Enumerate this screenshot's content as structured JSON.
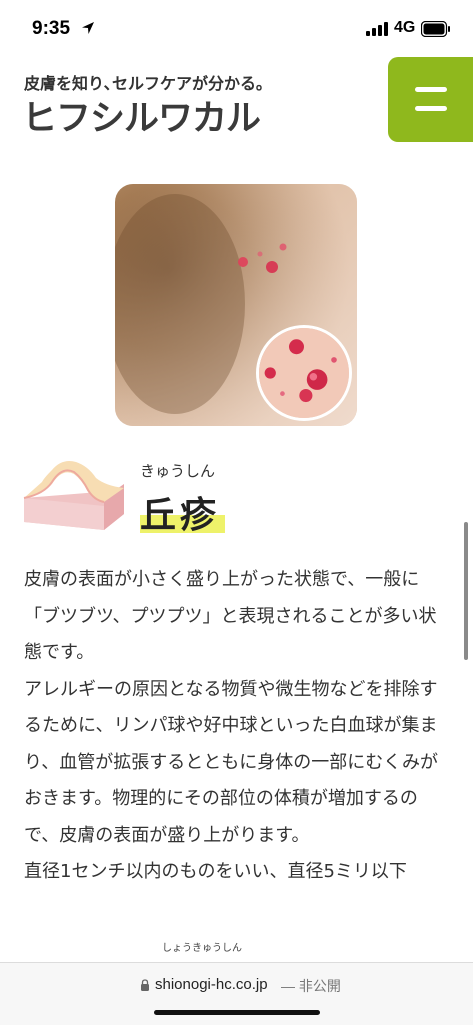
{
  "status_bar": {
    "time": "9:35",
    "network": "4G"
  },
  "header": {
    "tagline": "皮膚を知り､セルフケアが分かる｡",
    "logo": "ヒフシルワカル",
    "menu_icon": "hamburger-icon",
    "accent_color": "#8fb81d"
  },
  "term": {
    "reading": "きゅうしん",
    "name": "丘疹",
    "highlight_color": "#eef26a"
  },
  "body": {
    "paragraphs": [
      "皮膚の表面が小さく盛り上がった状態で、一般に「ブツブツ、プツプツ」と表現されることが多い状態です。",
      "アレルギーの原因となる物質や微生物などを排除するために、リンパ球や好中球といった白血球が集まり、血管が拡張するとともに身体の一部にむくみがおきます。物理的にその部位の体積が増加するので、皮膚の表面が盛り上がります。",
      "直径1センチ以内のものをいい、直径5ミリ以下"
    ],
    "ruby_fragment": "しょうきゅうしん"
  },
  "browser": {
    "url": "shionogi-hc.co.jp",
    "private_label": "— 非公開"
  }
}
